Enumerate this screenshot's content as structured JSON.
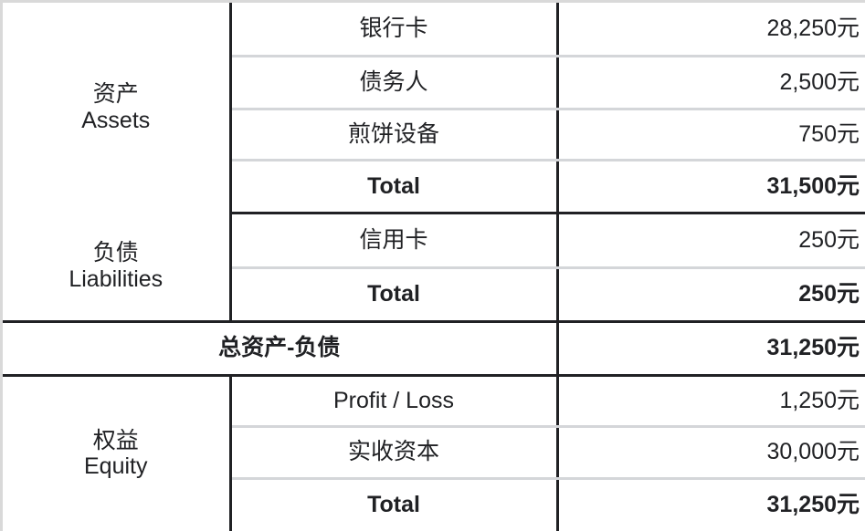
{
  "document": {
    "type": "balance-sheet-table",
    "currency_suffix": "元"
  },
  "colors": {
    "text": "#202124",
    "heavy_rule": "#202124",
    "light_rule": "#d4d6d9",
    "sheet_border": "#d9d9d9",
    "background": "#ffffff"
  },
  "sections": [
    {
      "id": "assets",
      "category_cn": "资产",
      "category_en": "Assets",
      "rows": [
        {
          "name": "银行卡",
          "value": "28,250元",
          "bold": false
        },
        {
          "name": "债务人",
          "value": "2,500元",
          "bold": false
        },
        {
          "name": "煎饼设备",
          "value": "750元",
          "bold": false
        },
        {
          "name": "Total",
          "value": "31,500元",
          "bold": true
        }
      ]
    },
    {
      "id": "liabilities",
      "category_cn": "负债",
      "category_en": "Liabilities",
      "rows": [
        {
          "name": "信用卡",
          "value": "250元",
          "bold": false
        },
        {
          "name": "Total",
          "value": "250元",
          "bold": true
        }
      ]
    },
    {
      "id": "net-assets",
      "merged_label": "总资产-负债",
      "value": "31,250元"
    },
    {
      "id": "equity",
      "category_cn": "权益",
      "category_en": "Equity",
      "rows": [
        {
          "name": "Profit / Loss",
          "value": "1,250元",
          "bold": false
        },
        {
          "name": "实收资本",
          "value": "30,000元",
          "bold": false
        },
        {
          "name": "Total",
          "value": "31,250元",
          "bold": true
        }
      ]
    }
  ]
}
